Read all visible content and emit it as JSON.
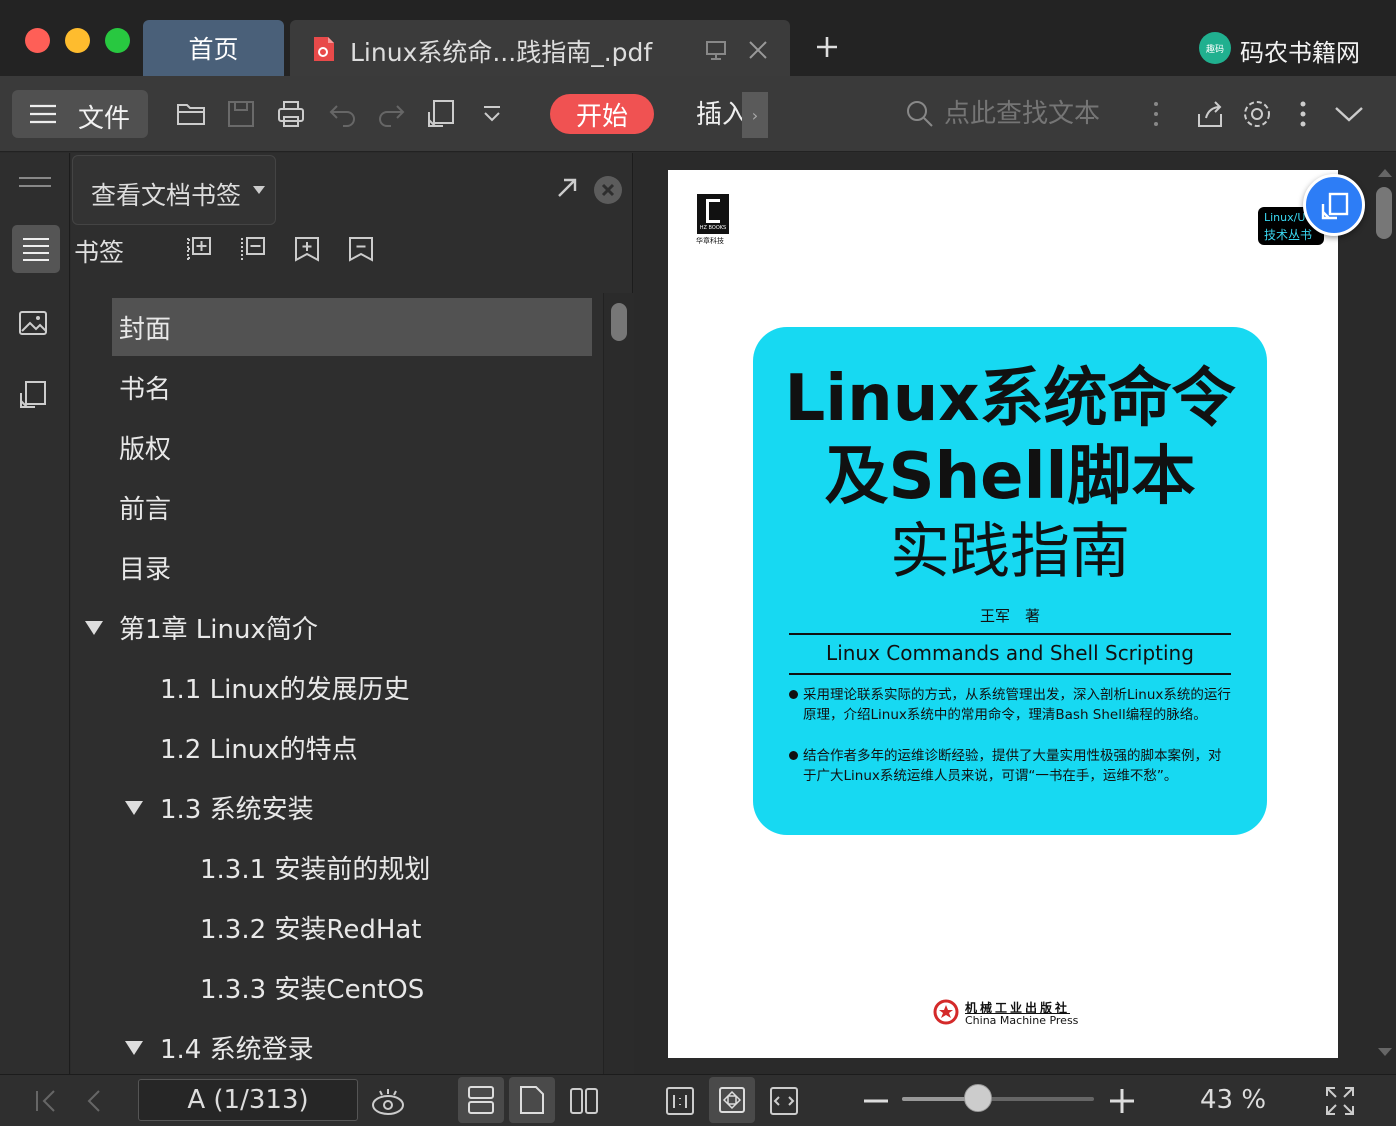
{
  "tabs": {
    "home": "首页",
    "document": "Linux系统命...践指南_.pdf",
    "brand": "码农书籍网",
    "brand_badge": "趣码"
  },
  "toolbar": {
    "file": "文件",
    "start": "开始",
    "insert": "插入",
    "search_placeholder": "点此查找文本",
    "accent": "#f05252"
  },
  "panel": {
    "dropdown": "查看文档书签",
    "bookmarks_label": "书签",
    "bookmarks": [
      {
        "label": "封面"
      },
      {
        "label": "书名"
      },
      {
        "label": "版权"
      },
      {
        "label": "前言"
      },
      {
        "label": "目录"
      },
      {
        "label": "第1章 Linux简介"
      },
      {
        "label": "1.1 Linux的发展历史"
      },
      {
        "label": "1.2 Linux的特点"
      },
      {
        "label": "1.3 系统安装"
      },
      {
        "label": "1.3.1 安装前的规划"
      },
      {
        "label": "1.3.2 安装RedHat"
      },
      {
        "label": "1.3.3 安装CentOS"
      },
      {
        "label": "1.4 系统登录"
      }
    ]
  },
  "cover": {
    "publisher_logo_text": "HZ BOOKS",
    "publisher_cn": "华章科技",
    "series_line1": "Linux/U",
    "series_line2": "技术丛书",
    "title_line1": "Linux系统命令",
    "title_line2": "及Shell脚本",
    "title_line3": "实践指南",
    "author": "王军　著",
    "english_title": "Linux Commands and Shell Scripting",
    "bullet1": "采用理论联系实际的方式，从系统管理出发，深入剖析Linux系统的运行原理，介绍Linux系统中的常用命令，理清Bash Shell编程的脉络。",
    "bullet2": "结合作者多年的运维诊断经验，提供了大量实用性极强的脚本案例，对于广大Linux系统运维人员来说，可谓“一书在手，运维不愁”。",
    "press_cn": "机械工业出版社",
    "press_en": "China Machine Press",
    "cover_color": "#17d9f2"
  },
  "status": {
    "page_indicator": "A (1/313)",
    "zoom": "43 %",
    "zoom_level": 0.43
  }
}
